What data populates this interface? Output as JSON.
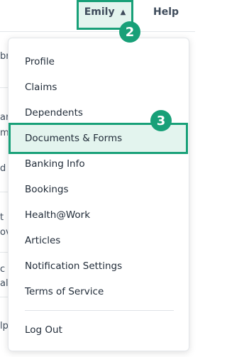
{
  "header": {
    "user_name": "Emily",
    "help_label": "Help"
  },
  "user_menu": {
    "items": [
      {
        "label": "Profile"
      },
      {
        "label": "Claims"
      },
      {
        "label": "Dependents"
      },
      {
        "label": "Documents & Forms"
      },
      {
        "label": "Banking Info"
      },
      {
        "label": "Bookings"
      },
      {
        "label": "Health@Work"
      },
      {
        "label": "Articles"
      },
      {
        "label": "Notification Settings"
      },
      {
        "label": "Terms of Service"
      }
    ],
    "logout_label": "Log Out",
    "highlighted_item": "Documents & Forms"
  },
  "steps": {
    "user_button_step": "2",
    "documents_step": "3"
  },
  "background_fragments": [
    "br",
    "ar",
    "m",
    "d",
    "t",
    "ov",
    "c",
    "alt",
    "lp"
  ],
  "colors": {
    "accent": "#18a078",
    "highlight_bg": "#e3f4ee",
    "text": "#1f2a37"
  },
  "icons": {
    "user_button_chevron": "chevron-up-icon"
  }
}
